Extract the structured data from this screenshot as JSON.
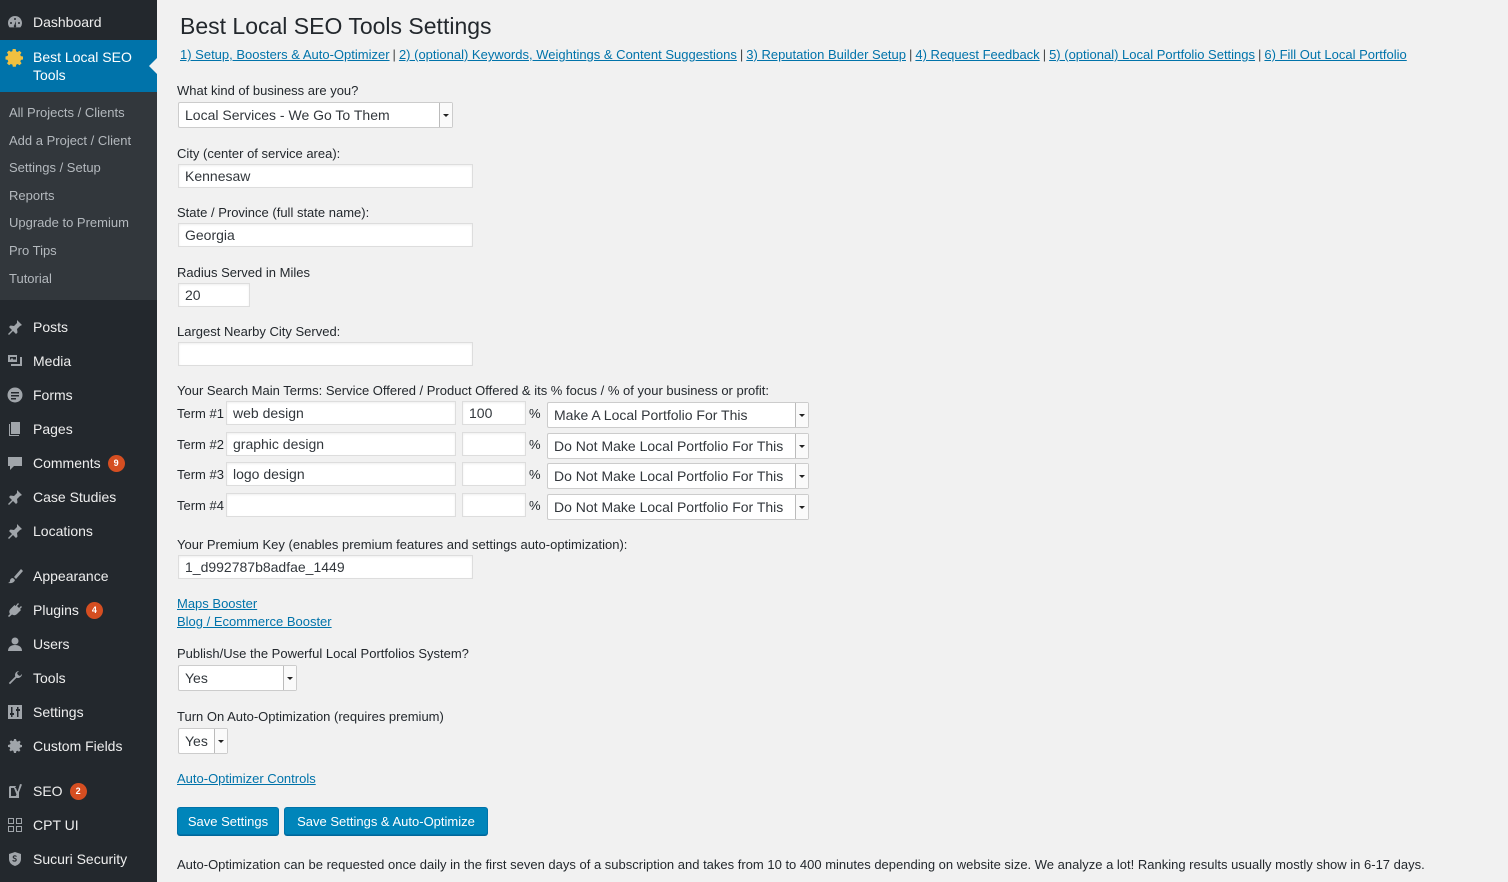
{
  "sidebar": {
    "dashboard": "Dashboard",
    "active": "Best Local SEO Tools",
    "submenu": [
      "All Projects / Clients",
      "Add a Project / Client",
      "Settings / Setup",
      "Reports",
      "Upgrade to Premium",
      "Pro Tips",
      "Tutorial"
    ],
    "posts": "Posts",
    "media": "Media",
    "forms": "Forms",
    "pages": "Pages",
    "comments": "Comments",
    "comments_badge": "9",
    "case_studies": "Case Studies",
    "locations": "Locations",
    "appearance": "Appearance",
    "plugins": "Plugins",
    "plugins_badge": "4",
    "users": "Users",
    "tools": "Tools",
    "settings": "Settings",
    "custom_fields": "Custom Fields",
    "seo": "SEO",
    "seo_badge": "2",
    "cpt_ui": "CPT UI",
    "sucuri": "Sucuri Security"
  },
  "page": {
    "title": "Best Local SEO Tools Settings",
    "steps": [
      "1) Setup, Boosters & Auto-Optimizer",
      "2) (optional) Keywords, Weightings & Content Suggestions",
      "3) Reputation Builder Setup",
      "4) Request Feedback",
      "5) (optional) Local Portfolio Settings",
      "6) Fill Out Local Portfolio"
    ],
    "separator": "|"
  },
  "form": {
    "business_type_label": "What kind of business are you?",
    "business_type_value": "Local Services - We Go To Them",
    "city_label": "City (center of service area):",
    "city_value": "Kennesaw",
    "state_label": "State / Province (full state name):",
    "state_value": "Georgia",
    "radius_label": "Radius Served in Miles",
    "radius_value": "20",
    "nearby_label": "Largest Nearby City Served:",
    "nearby_value": "",
    "terms_label": "Your Search Main Terms: Service Offered / Product Offered & its % focus / % of your business or profit:",
    "pct_symbol": "%",
    "terms": [
      {
        "label": "Term #1",
        "term": "web design",
        "percent": "100",
        "portfolio": "Make A Local Portfolio For This"
      },
      {
        "label": "Term #2",
        "term": "graphic design",
        "percent": "",
        "portfolio": "Do Not Make Local Portfolio For This"
      },
      {
        "label": "Term #3",
        "term": "logo design",
        "percent": "",
        "portfolio": "Do Not Make Local Portfolio For This"
      },
      {
        "label": "Term #4",
        "term": "",
        "percent": "",
        "portfolio": "Do Not Make Local Portfolio For This"
      }
    ],
    "premium_key_label": "Your Premium Key (enables premium features and settings auto-optimization):",
    "premium_key_value": "1_d992787b8adfae_1449",
    "maps_booster": "Maps Booster",
    "blog_booster": "Blog / Ecommerce Booster",
    "publish_label": "Publish/Use the Powerful Local Portfolios System?",
    "publish_value": "Yes",
    "auto_opt_label": "Turn On Auto-Optimization (requires premium)",
    "auto_opt_value": "Yes",
    "auto_opt_controls": "Auto-Optimizer Controls",
    "save_button": "Save Settings",
    "save_optimize_button": "Save Settings & Auto-Optimize",
    "footnote": "Auto-Optimization can be requested once daily in the first seven days of a subscription and takes from 10 to 400 minutes depending on website size. We analyze a lot! Ranking results usually mostly show in 6-17 days."
  },
  "colors": {
    "sidebar_bg": "#23282d",
    "submenu_bg": "#32373c",
    "active_bg": "#0073aa",
    "button_bg": "#0085ba",
    "badge_bg": "#d54e21",
    "link": "#0073aa"
  },
  "icons": {
    "dashboard": "gauge-icon",
    "active": "gear-icon",
    "posts": "pushpin-icon",
    "media": "media-icon",
    "forms": "forms-icon",
    "pages": "pages-icon",
    "comments": "comment-icon",
    "appearance": "brush-icon",
    "plugins": "plug-icon",
    "users": "user-icon",
    "tools": "wrench-icon",
    "settings": "sliders-icon",
    "seo": "yoast-icon",
    "cpt_ui": "grid-icon",
    "sucuri": "shield-icon"
  }
}
